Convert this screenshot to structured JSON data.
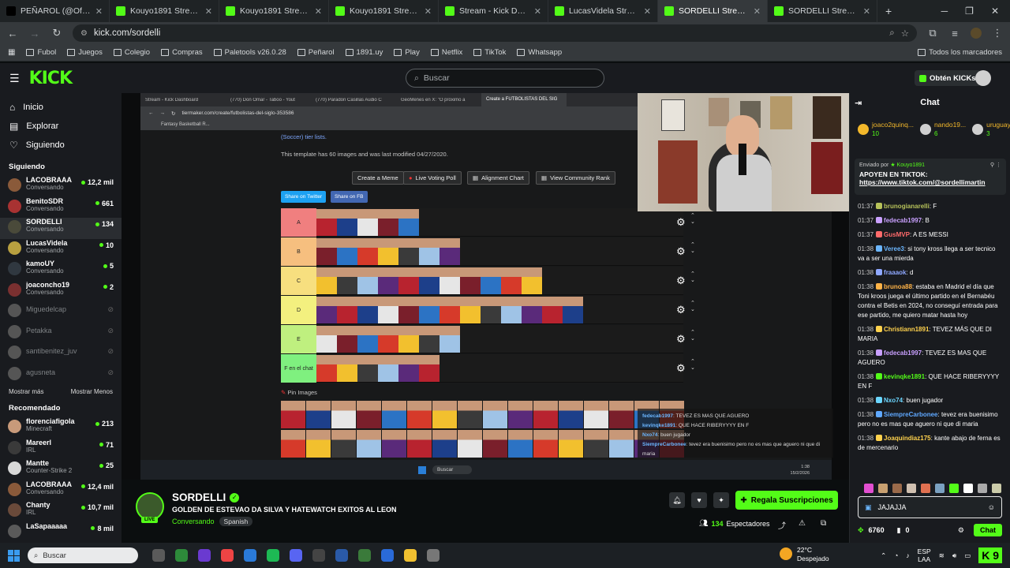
{
  "browser": {
    "tabs": [
      {
        "title": "PEÑAROL (@OficialCAP) /",
        "color": "#000000"
      },
      {
        "title": "Kouyo1891 Stream - Wat",
        "color": "#53fc18"
      },
      {
        "title": "Kouyo1891 Stream - Wat",
        "color": "#53fc18"
      },
      {
        "title": "Kouyo1891 Stream - Wat",
        "color": "#53fc18"
      },
      {
        "title": "Stream - Kick Dashboard",
        "color": "#53fc18"
      },
      {
        "title": "LucasVidela Stream -",
        "color": "#53fc18"
      },
      {
        "title": "SORDELLI Stream - W",
        "color": "#53fc18"
      },
      {
        "title": "SORDELLI Stream - Kick D",
        "color": "#53fc18"
      }
    ],
    "url": "kick.com/sordelli",
    "bookmarks": [
      "Fubol",
      "Juegos",
      "Colegio",
      "Compras",
      "Paletools v26.0.28",
      "Peñarol",
      "1891.uy",
      "Play",
      "Netflix",
      "TikTok",
      "Whatsapp"
    ],
    "all_bookmarks": "Todos los marcadores"
  },
  "header": {
    "logo": "KICK",
    "search_placeholder": "Buscar",
    "kicks_label": "Obtén KICKs"
  },
  "sidebar": {
    "nav": [
      {
        "label": "Inicio",
        "icon": "home-icon"
      },
      {
        "label": "Explorar",
        "icon": "explore-icon"
      },
      {
        "label": "Siguiendo",
        "icon": "heart-icon"
      }
    ],
    "following_title": "Siguiendo",
    "following": [
      {
        "name": "LACOBRAAA",
        "sub": "Conversando",
        "viewers": "12,2 mil",
        "color": "#8a5a3a"
      },
      {
        "name": "BenitoSDR",
        "sub": "Conversando",
        "viewers": "661",
        "color": "#a83232"
      },
      {
        "name": "SORDELLI",
        "sub": "Conversando",
        "viewers": "134",
        "color": "#4a4a3a"
      },
      {
        "name": "LucasVidela",
        "sub": "Conversando",
        "viewers": "10",
        "color": "#b8a040"
      },
      {
        "name": "kamoUY",
        "sub": "Conversando",
        "viewers": "5",
        "color": "#303840"
      },
      {
        "name": "joaconcho19",
        "sub": "Conversando",
        "viewers": "2",
        "color": "#7a3030"
      }
    ],
    "offline": [
      "Miguedelcap",
      "Petakka",
      "santibenitez_juv",
      "agusneta"
    ],
    "show_more": "Mostrar más",
    "show_less": "Mostrar Menos",
    "recommended_title": "Recomendado",
    "recommended": [
      {
        "name": "florenciafigola",
        "sub": "Minecraft",
        "viewers": "213",
        "color": "#c89a7a"
      },
      {
        "name": "Mareerl",
        "sub": "IRL",
        "viewers": "71",
        "color": "#3a3a3a"
      },
      {
        "name": "Mantte",
        "sub": "Counter-Strike 2",
        "viewers": "25",
        "color": "#d8d8d8"
      },
      {
        "name": "LACOBRAAA",
        "sub": "Conversando",
        "viewers": "12,4 mil",
        "color": "#8a5a3a"
      },
      {
        "name": "Chanty",
        "sub": "IRL",
        "viewers": "10,7 mil",
        "color": "#6a4a3a"
      },
      {
        "name": "LaSapaaaaa",
        "sub": "",
        "viewers": "8 mil",
        "color": "#5a5a5a"
      }
    ]
  },
  "stream_content": {
    "inner_tabs": [
      "Stream - Kick Dashboard",
      "(770) Don Omar - Taboo - Yout",
      "(770) Paradon Casillas Audio C",
      "GeoMenes en X: \"O próximo a",
      "Create a FUTBOLISTAS DEL SIG"
    ],
    "inner_url": "tiermaker.com/create/futbolistas-del-siglo-353586",
    "inner_bookmark": "Fantasy Basketball R...",
    "soccer_text": "(Soccer) tier lists.",
    "template_text": "This template has 60 images and was last modified 04/27/2020.",
    "buttons": [
      "Create a Meme",
      "Live Voting Poll",
      "Alignment Chart",
      "View Community Rank"
    ],
    "share_twitter": "Share on Twitter",
    "share_fb": "Share on FB",
    "tiers": [
      {
        "label": "A",
        "color": "#f07f7f",
        "count": 5
      },
      {
        "label": "B",
        "color": "#f6bf7f",
        "count": 7
      },
      {
        "label": "C",
        "color": "#f7df7f",
        "count": 11
      },
      {
        "label": "D",
        "color": "#f3f07f",
        "count": 13
      },
      {
        "label": "E",
        "color": "#bff07f",
        "count": 7
      },
      {
        "label": "F en el chat",
        "color": "#7ff07f",
        "count": 6
      }
    ],
    "pin_images": "Pin Images",
    "overlay_chat": [
      {
        "user": "fedecab1997",
        "text": "TEVEZ ES MAS QUE AGUERO"
      },
      {
        "user": "kevinqke1891",
        "text": "QUE HACE RIBERYYYY EN F"
      },
      {
        "user": "Nxo74",
        "text": "buen jugador"
      },
      {
        "user": "SiempreCarbonee",
        "text": "tevez era buenisimo pero no es mas que aguero ni que di maria"
      }
    ],
    "inner_taskbar_search": "Buscar",
    "inner_time": "1:38",
    "inner_date": "15/2/2026",
    "inner_lang": "ESP LAA"
  },
  "stream": {
    "name": "SORDELLI",
    "title": "GOLDEN DE ESTEVAO DA SILVA Y HATEWATCH EXITOS AL LEON",
    "category": "Conversando",
    "tag": "Spanish",
    "live": "LIVE",
    "subscribe_label": "Regala Suscripciones",
    "viewers": "134",
    "viewers_label": "Espectadores"
  },
  "chat": {
    "title": "Chat",
    "gifters": [
      {
        "name": "joaco2quinq...",
        "count": "10"
      },
      {
        "name": "nando19...",
        "count": "6"
      },
      {
        "name": "uruguay...",
        "count": "3"
      }
    ],
    "pinned_by_label": "Enviado por",
    "pinned_by": "Kouyo1891",
    "pinned_text": "APOYEN EN TIKTOK:",
    "pinned_link": "https://www.tiktok.com/@sordellimartin",
    "messages": [
      {
        "time": "01:37",
        "user": "brunogianarelli",
        "text": "F",
        "color": "#b7c25a"
      },
      {
        "time": "01:37",
        "user": "fedecab1997",
        "text": "B",
        "color": "#c9a0ff"
      },
      {
        "time": "01:37",
        "user": "GusMVP",
        "text": "A ES MESSI",
        "color": "#ff6b6b"
      },
      {
        "time": "01:38",
        "user": "Veree3",
        "text": "si tony kross llega a ser tecnico va a ser una mierda",
        "color": "#6bb6ff"
      },
      {
        "time": "01:38",
        "user": "fraaaok",
        "text": "d",
        "color": "#8fa8ff"
      },
      {
        "time": "01:38",
        "user": "brunoa88",
        "text": "estaba en Madrid el día que Toni kroos juega el último partido en el Bernabéu contra el Betis en 2024, no conseguí entrada para ese partido, me quiero matar hasta hoy",
        "color": "#ffb347"
      },
      {
        "time": "01:38",
        "user": "Christiann1891",
        "text": "TEVEZ MÁS QUE DI MARIA",
        "color": "#ffd24d"
      },
      {
        "time": "01:38",
        "user": "fedecab1997",
        "text": "TEVEZ ES MAS QUE AGUERO",
        "color": "#c9a0ff"
      },
      {
        "time": "01:38",
        "user": "kevinqke1891",
        "text": "QUE HACE RIBERYYYY EN F",
        "color": "#53fc18"
      },
      {
        "time": "01:38",
        "user": "Nxo74",
        "text": "buen jugador",
        "color": "#6bd6ff"
      },
      {
        "time": "01:38",
        "user": "SiempreCarbonee",
        "text": "tevez era buenisimo pero no es mas que aguero ni que di maria",
        "color": "#5fa8ff"
      },
      {
        "time": "01:38",
        "user": "Joaquindiaz175",
        "text": "kante abajo de ferna es de mercenario",
        "color": "#ffd24d"
      }
    ],
    "input_value": "JAJAJJA",
    "points": "6760",
    "count": "0",
    "send_label": "Chat"
  },
  "taskbar": {
    "search": "Buscar",
    "temp": "22°C",
    "weather": "Despejado",
    "lang": "ESP",
    "lang2": "LAA"
  }
}
